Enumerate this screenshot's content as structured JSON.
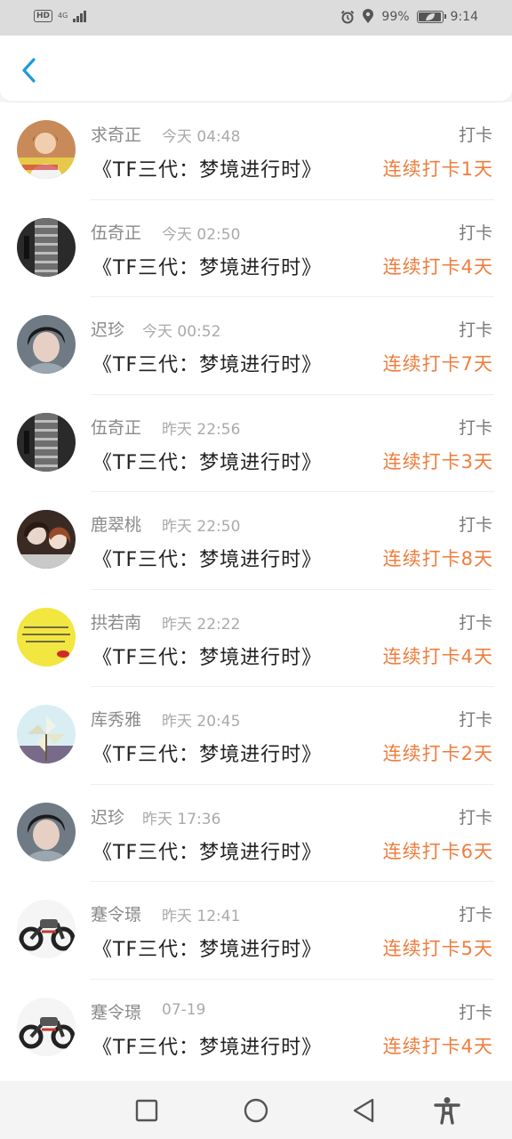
{
  "status_bar": {
    "hd": "HD",
    "network": "4G",
    "battery_pct_text": "99%",
    "battery_level": 0.99,
    "time": "9:14",
    "icons": [
      "alarm-icon",
      "location-icon",
      "battery-icon"
    ]
  },
  "header": {
    "back_icon": "chevron-left-icon",
    "accent": "#1e9bd7"
  },
  "colors": {
    "streak": "#ef7d3d",
    "name": "#8a8a8a",
    "title": "#222222"
  },
  "items": [
    {
      "name": "求奇正",
      "time": "今天 04:48",
      "kind": "打卡",
      "title": "《TF三代：梦境进行时》",
      "streak": "连续打卡1天",
      "avatar": "woman-portrait"
    },
    {
      "name": "伍奇正",
      "time": "今天 02:50",
      "kind": "打卡",
      "title": "《TF三代：梦境进行时》",
      "streak": "连续打卡4天",
      "avatar": "stairs-bw"
    },
    {
      "name": "迟珍",
      "time": "今天 00:52",
      "kind": "打卡",
      "title": "《TF三代：梦境进行时》",
      "streak": "连续打卡7天",
      "avatar": "boy-portrait"
    },
    {
      "name": "伍奇正",
      "time": "昨天 22:56",
      "kind": "打卡",
      "title": "《TF三代：梦境进行时》",
      "streak": "连续打卡3天",
      "avatar": "stairs-bw"
    },
    {
      "name": "鹿翠桃",
      "time": "昨天 22:50",
      "kind": "打卡",
      "title": "《TF三代：梦境进行时》",
      "streak": "连续打卡8天",
      "avatar": "girls-photo"
    },
    {
      "name": "拱若南",
      "time": "昨天 22:22",
      "kind": "打卡",
      "title": "《TF三代：梦境进行时》",
      "streak": "连续打卡4天",
      "avatar": "yellow-text"
    },
    {
      "name": "库秀雅",
      "time": "昨天 20:45",
      "kind": "打卡",
      "title": "《TF三代：梦境进行时》",
      "streak": "连续打卡2天",
      "avatar": "pinwheel"
    },
    {
      "name": "迟珍",
      "time": "昨天 17:36",
      "kind": "打卡",
      "title": "《TF三代：梦境进行时》",
      "streak": "连续打卡6天",
      "avatar": "boy-portrait"
    },
    {
      "name": "蹇令璟",
      "time": "昨天 12:41",
      "kind": "打卡",
      "title": "《TF三代：梦境进行时》",
      "streak": "连续打卡5天",
      "avatar": "motorcycle"
    },
    {
      "name": "蹇令璟",
      "time": "07-19",
      "kind": "打卡",
      "title": "《TF三代：梦境进行时》",
      "streak": "连续打卡4天",
      "avatar": "motorcycle"
    }
  ],
  "nav_bar": {
    "icons": [
      "recent-apps-icon",
      "home-icon",
      "back-icon",
      "accessibility-icon"
    ]
  }
}
